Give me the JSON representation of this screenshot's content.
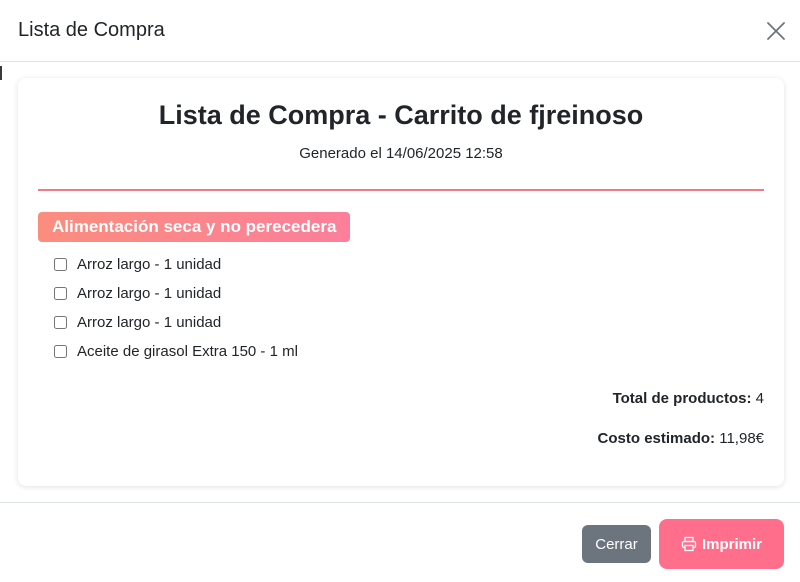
{
  "modal": {
    "title": "Lista de Compra",
    "close_icon": "close-icon"
  },
  "list": {
    "title": "Lista de Compra - Carrito de fjreinoso",
    "generated": "Generado el 14/06/2025 12:58",
    "accent_color": "#f07a8a",
    "category": "Alimentación seca y no perecedera",
    "items": [
      {
        "label": "Arroz largo - 1 unidad",
        "checked": false
      },
      {
        "label": "Arroz largo - 1 unidad",
        "checked": false
      },
      {
        "label": "Arroz largo - 1 unidad",
        "checked": false
      },
      {
        "label": "Aceite de girasol Extra 150 - 1 ml",
        "checked": false
      }
    ],
    "total_label": "Total de productos:",
    "total_value": "4",
    "cost_label": "Costo estimado:",
    "cost_value": "11,98€"
  },
  "footer": {
    "close_label": "Cerrar",
    "print_label": "Imprimir",
    "print_icon": "printer-icon"
  }
}
